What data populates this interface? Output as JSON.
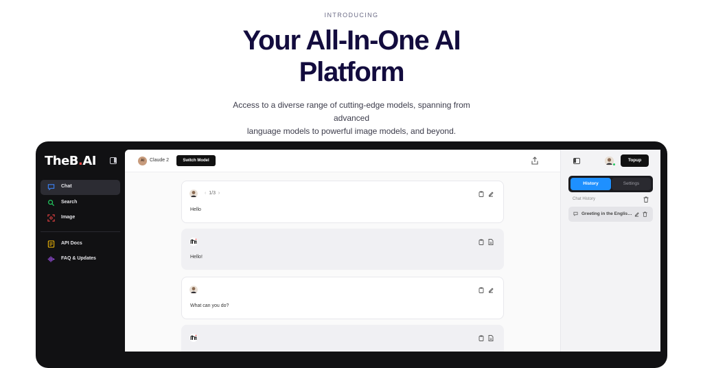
{
  "hero": {
    "eyebrow": "INTRODUCING",
    "headline_line1": "Your All-In-One AI",
    "headline_line2": "Platform",
    "subtitle_line1": "Access to a diverse range of cutting-edge models, spanning from advanced",
    "subtitle_line2": "language models to powerful image models, and beyond."
  },
  "sidebar": {
    "logo_part1": "TheB",
    "logo_dot": ".",
    "logo_part2": "AI",
    "items": [
      {
        "label": "Chat",
        "icon": "chat-bubble-icon",
        "color": "#3b82f6",
        "active": true
      },
      {
        "label": "Search",
        "icon": "search-icon",
        "color": "#22c55e",
        "active": false
      },
      {
        "label": "Image",
        "icon": "image-scan-icon",
        "color": "#ef4444",
        "active": false
      },
      {
        "label": "API Docs",
        "icon": "document-icon",
        "color": "#eab308",
        "active": false
      },
      {
        "label": "FAQ & Updates",
        "icon": "audio-wave-icon",
        "color": "#a855f7",
        "active": false
      }
    ]
  },
  "topbar": {
    "model_avatar": "AI",
    "model_name": "Claude 2",
    "switch_label": "Switch Model"
  },
  "messages": [
    {
      "role": "user",
      "text": "Hello",
      "pager": "1/3"
    },
    {
      "role": "bot",
      "text": "Hello!"
    },
    {
      "role": "user",
      "text": "What can you do?"
    },
    {
      "role": "bot",
      "text": ""
    }
  ],
  "right_panel": {
    "topup_label": "Topup",
    "tab_history": "History",
    "tab_settings": "Settings",
    "chat_history_label": "Chat History",
    "history_items": [
      "Greeting in the English language"
    ]
  },
  "colors": {
    "headline": "#130c3e",
    "accent_blue": "#1e90ff",
    "frame": "#111113",
    "online": "#22c55e"
  }
}
